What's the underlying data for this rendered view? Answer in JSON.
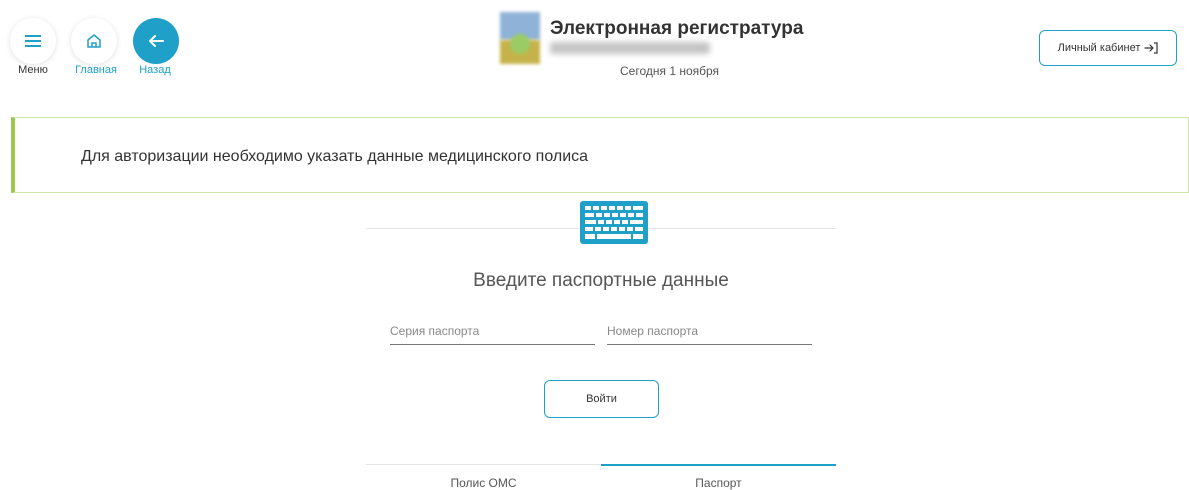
{
  "nav": {
    "menu_label": "Меню",
    "home_label": "Главная",
    "back_label": "Назад",
    "menu_icon": "hamburger-icon",
    "home_icon": "home-icon",
    "back_icon": "arrow-left-icon"
  },
  "header": {
    "title": "Электронная регистратура",
    "today": "Сегодня 1 ноября",
    "cabinet_label": "Личный кабинет",
    "cabinet_icon": "login-arrow-icon"
  },
  "notice": {
    "text": "Для авторизации необходимо указать данные медицинского полиса"
  },
  "form": {
    "heading": "Введите паспортные данные",
    "series_placeholder": "Серия паспорта",
    "series_value": "",
    "number_placeholder": "Номер паспорта",
    "number_value": "",
    "submit_label": "Войти",
    "icon": "keyboard-icon"
  },
  "tabs": [
    {
      "label": "Полис ОМС",
      "active": false
    },
    {
      "label": "Паспорт",
      "active": true
    }
  ],
  "colors": {
    "accent": "#1ea0c8",
    "notice_border": "#9ccb4a"
  }
}
